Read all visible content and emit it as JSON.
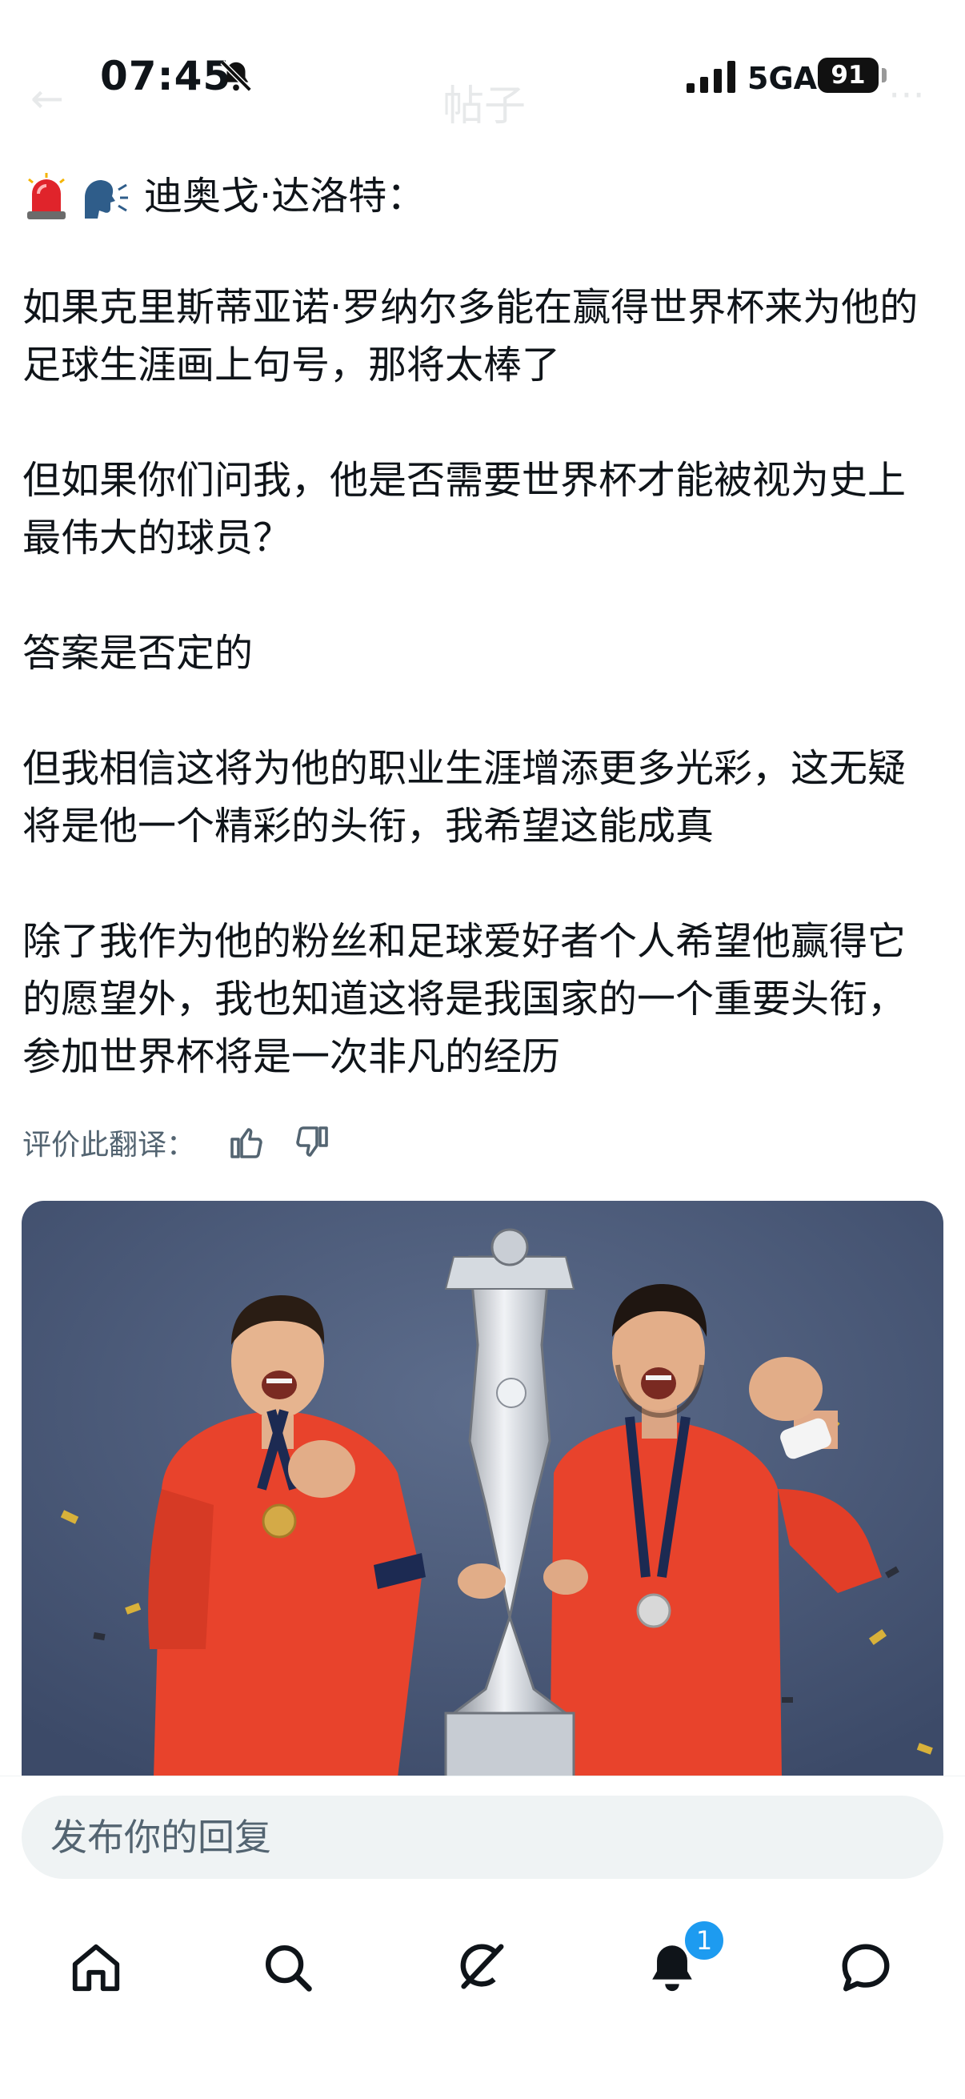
{
  "status_bar": {
    "time": "07:45",
    "network": "5GA",
    "battery": "91"
  },
  "header": {
    "back_icon": "arrow-left-icon",
    "title": "帖子",
    "more_icon": "more-icon"
  },
  "post": {
    "emoji": [
      "police-light-icon",
      "speaking-head-icon"
    ],
    "author_line": "迪奥戈·达洛特：",
    "body": "如果克里斯蒂亚诺·罗纳尔多能在赢得世界杯来为他的足球生涯画上句号，那将太棒了\n\n但如果你们问我，他是否需要世界杯才能被视为史上最伟大的球员？\n\n答案是否定的\n\n但我相信这将为他的职业生涯增添更多光彩，这无疑将是他一个精彩的头衔，我希望这能成真\n\n除了我作为他的粉丝和足球爱好者个人希望他赢得它的愿望外，我也知道这将是我国家的一个重要头衔，参加世界杯将是一次非凡的经历",
    "rate_label": "评价此翻译：",
    "image_alt": "photo-two-players-with-trophy"
  },
  "reply": {
    "placeholder": "发布你的回复"
  },
  "nav": {
    "items": [
      "home-icon",
      "search-icon",
      "grok-icon",
      "notifications-icon",
      "messages-icon"
    ],
    "notification_badge": "1"
  },
  "colors": {
    "accent": "#1d9bf0",
    "secondary_text": "#536471",
    "jersey": "#e8422c",
    "background_photo": "#4a5a78"
  }
}
